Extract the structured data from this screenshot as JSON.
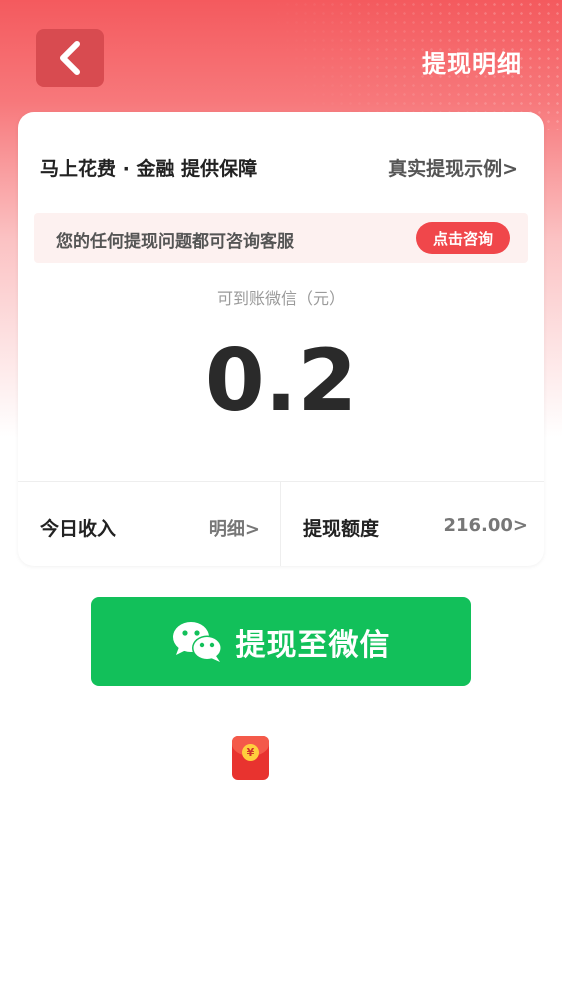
{
  "header": {
    "back_icon": "chevron-left-icon",
    "detail_link": "提现明细"
  },
  "card": {
    "guarantee_text": "马上花费 · 金融 提供保障",
    "example_link": "真实提现示例>",
    "notice": {
      "text": "您的任何提现问题都可咨询客服",
      "consult_button": "点击咨询"
    },
    "amount": {
      "caption": "可到账微信（元）",
      "value": "0.2"
    },
    "stats": {
      "today_income_label": "今日收入",
      "today_income_link": "明细>",
      "quota_label": "提现额度",
      "quota_value": "216.00>"
    }
  },
  "withdraw": {
    "icon": "wechat-icon",
    "label": "提现至微信"
  },
  "redpacket": {
    "icon": "red-envelope-icon",
    "coin_symbol": "¥"
  },
  "colors": {
    "brand_red": "#f45a5e",
    "consult_red": "#f0474b",
    "wechat_green": "#12c05a",
    "redpacket_red": "#e8332f"
  }
}
